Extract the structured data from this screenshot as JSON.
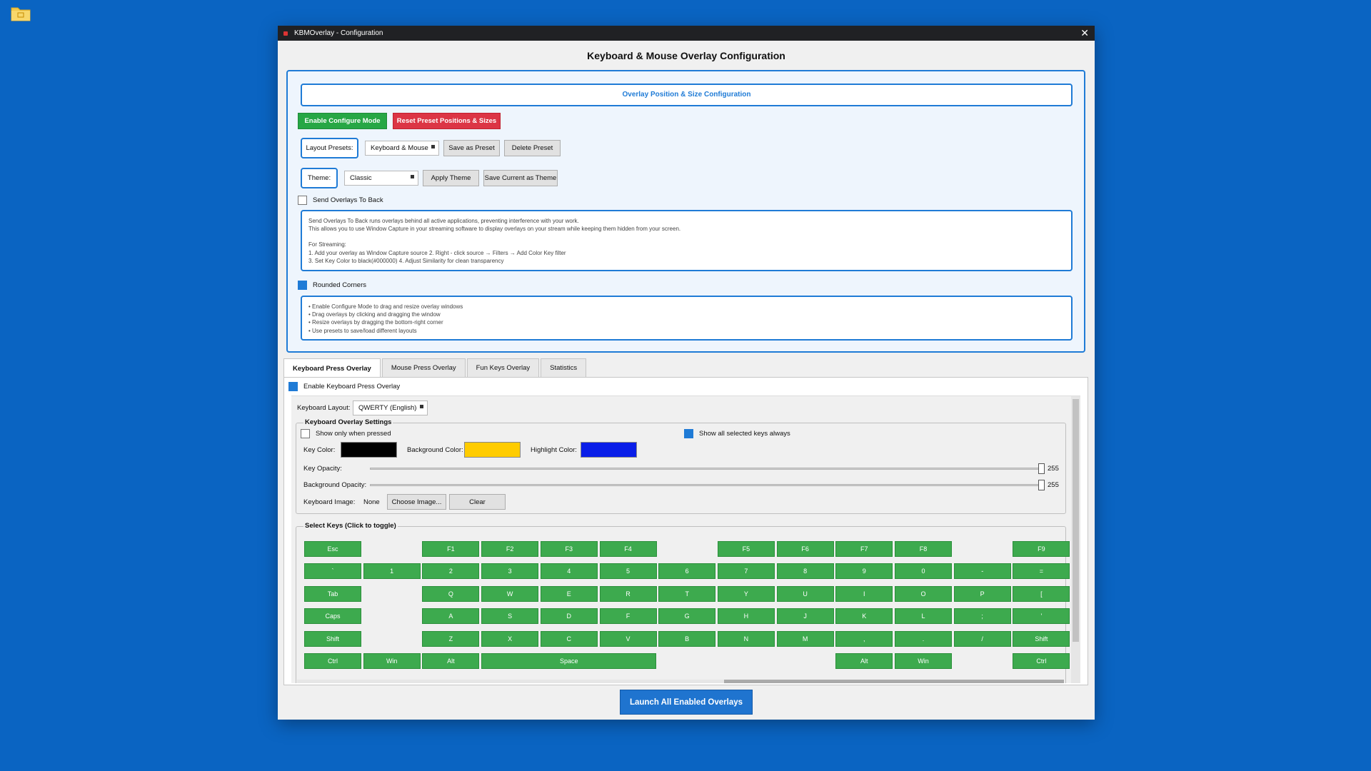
{
  "window": {
    "title": "KBMOverlay - Configuration",
    "heading": "Keyboard & Mouse Overlay Configuration"
  },
  "config": {
    "header": "Overlay Position & Size Configuration",
    "enable_configure_mode": "Enable Configure Mode",
    "reset_positions": "Reset Preset Positions & Sizes",
    "layout_presets_label": "Layout Presets:",
    "layout_preset_value": "Keyboard & Mouse",
    "save_as_preset": "Save as Preset",
    "delete_preset": "Delete Preset",
    "theme_label": "Theme:",
    "theme_value": "Classic",
    "apply_theme": "Apply Theme",
    "save_current_theme": "Save Current as Theme",
    "send_to_back_label": "Send Overlays To Back",
    "send_to_back_checked": false,
    "send_to_back_info": [
      "Send Overlays To Back runs overlays behind all active applications, preventing interference with your work.",
      "This allows you to use Window Capture in your streaming software to display overlays on your stream while keeping them hidden from your screen.",
      "",
      "For Streaming:",
      "1. Add your overlay as Window Capture source 2. Right - click source → Filters → Add Color Key filter",
      "3. Set Key Color to black(#000000) 4. Adjust Similarity for clean transparency"
    ],
    "rounded_corners_label": "Rounded Corners",
    "rounded_corners_checked": true,
    "tips": [
      "• Enable Configure Mode to drag and resize overlay windows",
      "• Drag overlays by clicking and dragging the window",
      "• Resize overlays by dragging the bottom-right corner",
      "• Use presets to save/load different layouts"
    ]
  },
  "tabs": [
    {
      "label": "Keyboard Press Overlay",
      "active": true
    },
    {
      "label": "Mouse Press Overlay",
      "active": false
    },
    {
      "label": "Fun Keys Overlay",
      "active": false
    },
    {
      "label": "Statistics",
      "active": false
    }
  ],
  "keyboard_tab": {
    "enable_label": "Enable Keyboard Press Overlay",
    "enable_checked": true,
    "layout_label": "Keyboard Layout:",
    "layout_value": "QWERTY (English)",
    "settings_title": "Keyboard Overlay Settings",
    "show_only_pressed": "Show only when pressed",
    "show_only_pressed_checked": false,
    "show_all_selected": "Show all selected keys always",
    "show_all_selected_checked": true,
    "key_color_label": "Key Color:",
    "key_color": "#000000",
    "background_color_label": "Background Color:",
    "background_color": "#ffcc00",
    "highlight_color_label": "Highlight Color:",
    "highlight_color": "#0a1ee8",
    "key_opacity_label": "Key Opacity:",
    "key_opacity": "255",
    "background_opacity_label": "Background Opacity:",
    "background_opacity": "255",
    "keyboard_image_label": "Keyboard Image:",
    "keyboard_image_value": "None",
    "choose_image": "Choose Image...",
    "clear": "Clear",
    "select_keys_title": "Select Keys (Click to toggle)",
    "key_color_accent": "#3daa4e",
    "key_rows": [
      [
        "Esc",
        "F1",
        "F2",
        "F3",
        "F4",
        "F5",
        "F6",
        "F7",
        "F8",
        "F9"
      ],
      [
        "`",
        "1",
        "2",
        "3",
        "4",
        "5",
        "6",
        "7",
        "8",
        "9",
        "0",
        "-",
        "="
      ],
      [
        "Tab",
        "Q",
        "W",
        "E",
        "R",
        "T",
        "Y",
        "U",
        "I",
        "O",
        "P",
        "["
      ],
      [
        "Caps",
        "A",
        "S",
        "D",
        "F",
        "G",
        "H",
        "J",
        "K",
        "L",
        ";",
        "'"
      ],
      [
        "Shift",
        "Z",
        "X",
        "C",
        "V",
        "B",
        "N",
        "M",
        ",",
        ".",
        "/",
        "Shift"
      ],
      [
        "Ctrl",
        "Win",
        "Alt",
        "Space",
        "Alt",
        "Win",
        "Ctrl"
      ]
    ]
  },
  "launch_button": "Launch All Enabled Overlays"
}
